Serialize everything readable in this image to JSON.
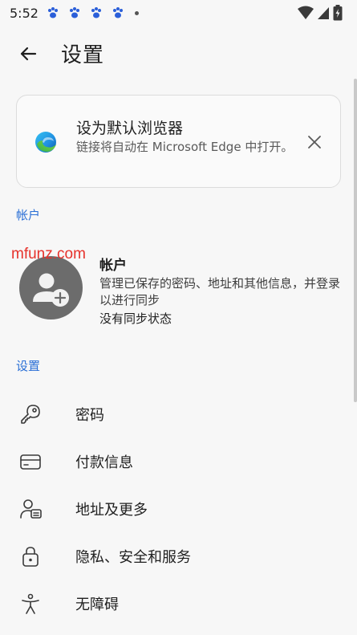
{
  "status_bar": {
    "time": "5:52",
    "notification_icons": [
      "paw-icon",
      "paw-icon",
      "paw-icon",
      "paw-icon"
    ]
  },
  "app_bar": {
    "title": "设置"
  },
  "promo_card": {
    "title": "设为默认浏览器",
    "description": "链接将自动在 Microsoft Edge 中打开。"
  },
  "sections": {
    "account_header": "帐户",
    "settings_header": "设置"
  },
  "account": {
    "watermark": "mfunz.com",
    "title": "帐户",
    "description": "管理已保存的密码、地址和其他信息，并登录以进行同步",
    "sync_status": "没有同步状态"
  },
  "settings_items": [
    {
      "label": "密码",
      "icon": "key-icon"
    },
    {
      "label": "付款信息",
      "icon": "credit-card-icon"
    },
    {
      "label": "地址及更多",
      "icon": "contact-card-icon"
    },
    {
      "label": "隐私、安全和服务",
      "icon": "lock-icon"
    },
    {
      "label": "无障碍",
      "icon": "accessibility-icon"
    }
  ],
  "colors": {
    "accent": "#2a6fd6",
    "background": "#f7f7f7",
    "avatar_bg": "#6c6c6c",
    "watermark": "#e6322b"
  }
}
